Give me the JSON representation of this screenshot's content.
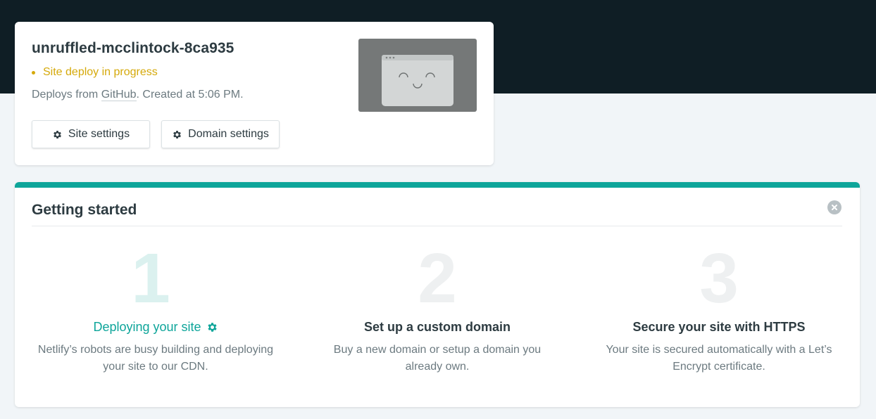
{
  "site": {
    "name": "unruffled-mcclintock-8ca935",
    "status": "Site deploy in progress",
    "deploy_prefix": "Deploys from ",
    "repo_host": "GitHub",
    "deploy_suffix": ". Created at 5:06 PM.",
    "buttons": {
      "site_settings": "Site settings",
      "domain_settings": "Domain settings"
    },
    "status_color": "#d5a90a"
  },
  "getting_started": {
    "title": "Getting started",
    "accent_color": "#0ea59a",
    "steps": [
      {
        "number": "1",
        "title": "Deploying your site",
        "description": "Netlify’s robots are busy building and deploying your site to our CDN.",
        "icon": "gear-icon",
        "active": true
      },
      {
        "number": "2",
        "title": "Set up a custom domain",
        "description": "Buy a new domain or setup a domain you already own.",
        "active": false
      },
      {
        "number": "3",
        "title": "Secure your site with HTTPS",
        "description": "Your site is secured automatically with a Let’s Encrypt certificate.",
        "active": false
      }
    ]
  }
}
